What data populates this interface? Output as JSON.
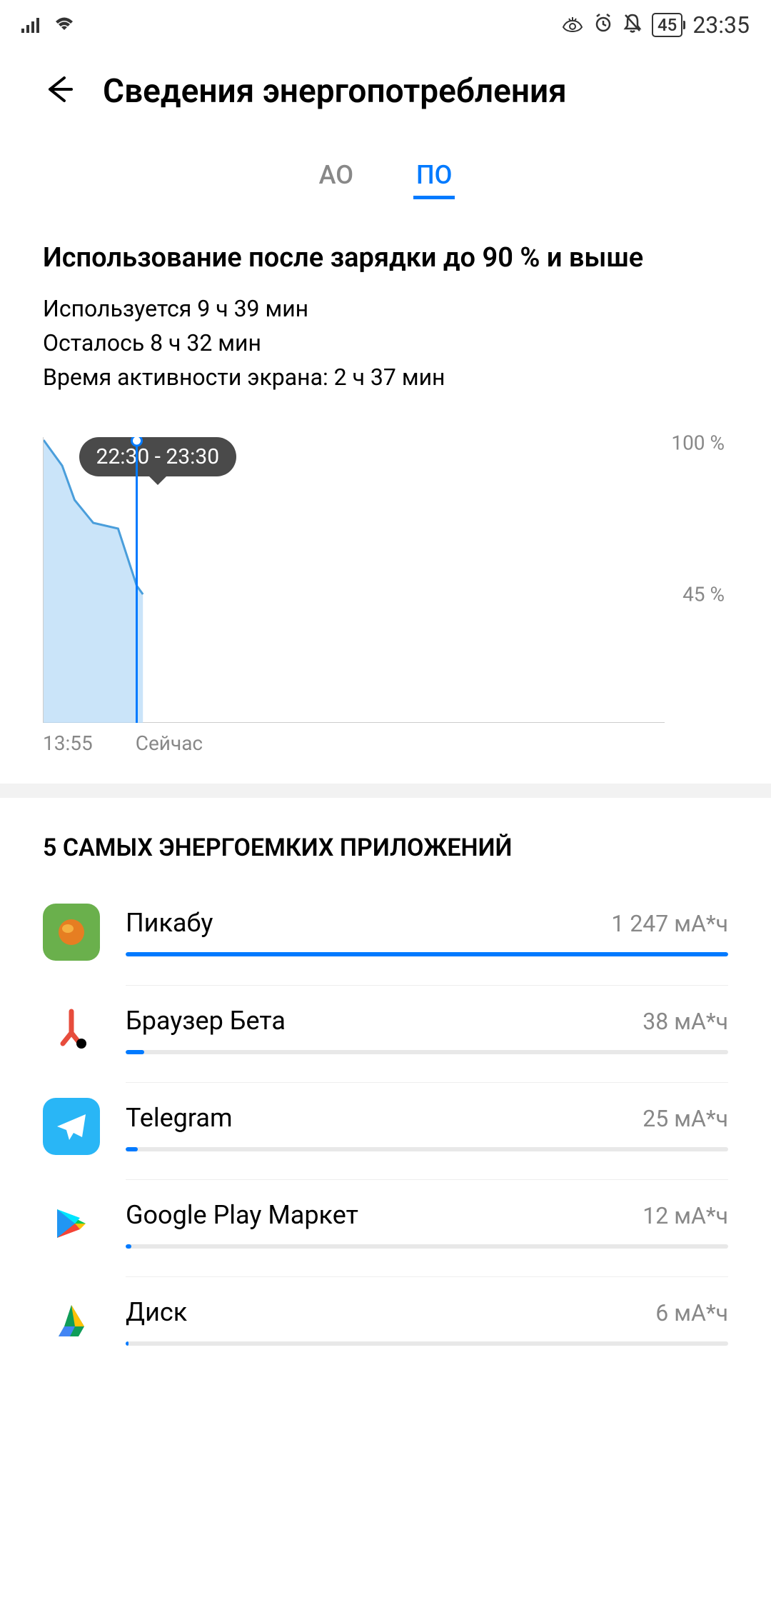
{
  "status": {
    "battery_pct": "45",
    "time": "23:35"
  },
  "header": {
    "title": "Сведения энергопотребления"
  },
  "tabs": {
    "hardware": "АО",
    "software": "ПО"
  },
  "usage": {
    "title": "Использование после зарядки до 90 % и выше",
    "used": "Используется 9 ч 39 мин",
    "remaining": "Осталось 8 ч 32 мин",
    "screen_on": "Время активности экрана: 2 ч 37 мин"
  },
  "chart_data": {
    "type": "area",
    "tooltip": "22:30 - 23:30",
    "ylabels": {
      "top": "100 %",
      "mid": "45 %"
    },
    "xlabels": {
      "start": "13:55",
      "now": "Сейчас"
    },
    "ylim": [
      0,
      100
    ],
    "points": [
      {
        "x": 0,
        "y": 99
      },
      {
        "x": 3,
        "y": 90
      },
      {
        "x": 5,
        "y": 78
      },
      {
        "x": 8,
        "y": 70
      },
      {
        "x": 12,
        "y": 68
      },
      {
        "x": 15,
        "y": 48
      },
      {
        "x": 16,
        "y": 45
      }
    ],
    "marker_x_pct": 15
  },
  "apps": {
    "heading": "5 САМЫХ ЭНЕРГОЕМКИХ ПРИЛОЖЕНИЙ",
    "items": [
      {
        "name": "Пикабу",
        "usage": "1 247 мА*ч",
        "pct": 100,
        "icon_bg": "#6ab04c",
        "icon_inner": "#e67e22"
      },
      {
        "name": "Браузер Бета",
        "usage": "38 мА*ч",
        "pct": 3.05,
        "icon_bg": "#ffffff",
        "icon_fg": "#e74c3c"
      },
      {
        "name": "Telegram",
        "usage": "25 мА*ч",
        "pct": 2.0,
        "icon_bg": "#29b6f6",
        "icon_fg": "#ffffff"
      },
      {
        "name": "Google Play Маркет",
        "usage": "12 мА*ч",
        "pct": 0.96,
        "icon_bg": "#ffffff"
      },
      {
        "name": "Диск",
        "usage": "6 мА*ч",
        "pct": 0.48,
        "icon_bg": "#ffffff"
      }
    ]
  }
}
